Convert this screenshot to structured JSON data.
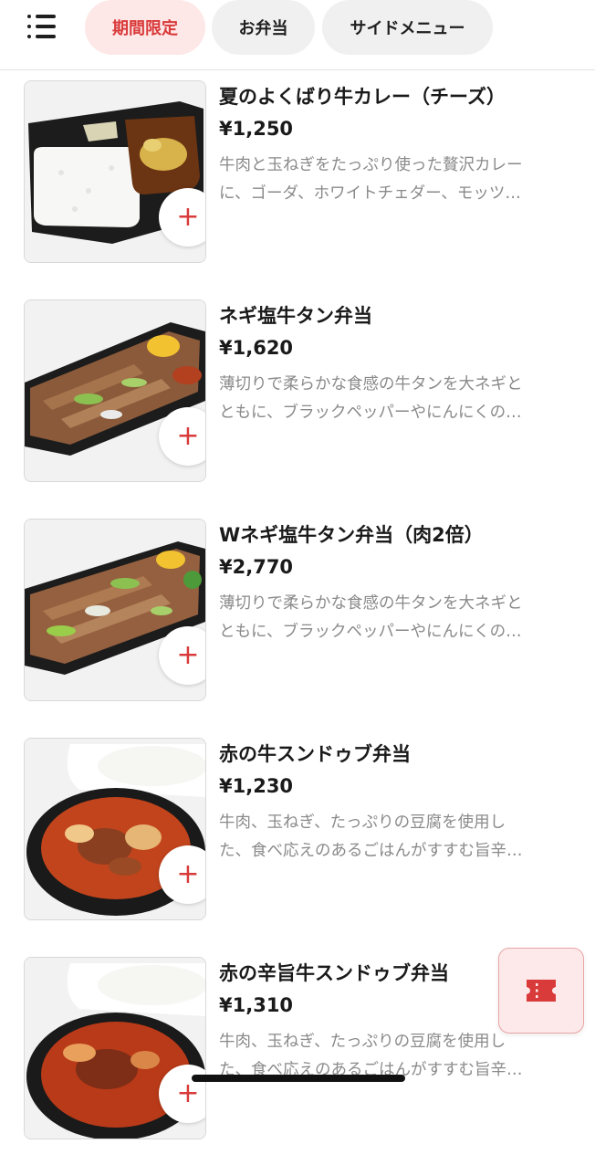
{
  "header": {
    "menu_icon": "menu-list-icon",
    "tabs": [
      {
        "label": "期間限定",
        "active": true
      },
      {
        "label": "お弁当",
        "active": false
      },
      {
        "label": "サイドメニュー",
        "active": false
      }
    ]
  },
  "items": [
    {
      "name": "夏のよくばり牛カレー（チーズ）",
      "price": "¥1,250",
      "desc_line1": "牛肉と玉ねぎをたっぷり使った贅沢カレー",
      "desc_line2": "に、ゴーダ、ホワイトチェダー、モッツ…",
      "add_label": "+"
    },
    {
      "name": "ネギ塩牛タン弁当",
      "price": "¥1,620",
      "desc_line1": "薄切りで柔らかな食感の牛タンを大ネギと",
      "desc_line2": "ともに、ブラックペッパーやにんにくの…",
      "add_label": "+"
    },
    {
      "name": "Wネギ塩牛タン弁当（肉2倍）",
      "price": "¥2,770",
      "desc_line1": "薄切りで柔らかな食感の牛タンを大ネギと",
      "desc_line2": "ともに、ブラックペッパーやにんにくの…",
      "add_label": "+"
    },
    {
      "name": "赤の牛スンドゥブ弁当",
      "price": "¥1,230",
      "desc_line1": "牛肉、玉ねぎ、たっぷりの豆腐を使用し",
      "desc_line2": "た、食べ応えのあるごはんがすすむ旨辛…",
      "add_label": "+"
    },
    {
      "name": "赤の辛旨牛スンドゥブ弁当",
      "price": "¥1,310",
      "desc_line1": "牛肉、玉ねぎ、たっぷりの豆腐を使用し",
      "desc_line2": "た、食べ応えのあるごはんがすすむ旨辛…",
      "add_label": "+"
    }
  ],
  "floating": {
    "coupon_icon": "coupon-ticket-icon"
  },
  "colors": {
    "accent": "#d93a3a",
    "chip_active_bg": "#fde7e7",
    "chip_bg": "#f0f0f0",
    "desc_text": "#8a8a8a"
  }
}
